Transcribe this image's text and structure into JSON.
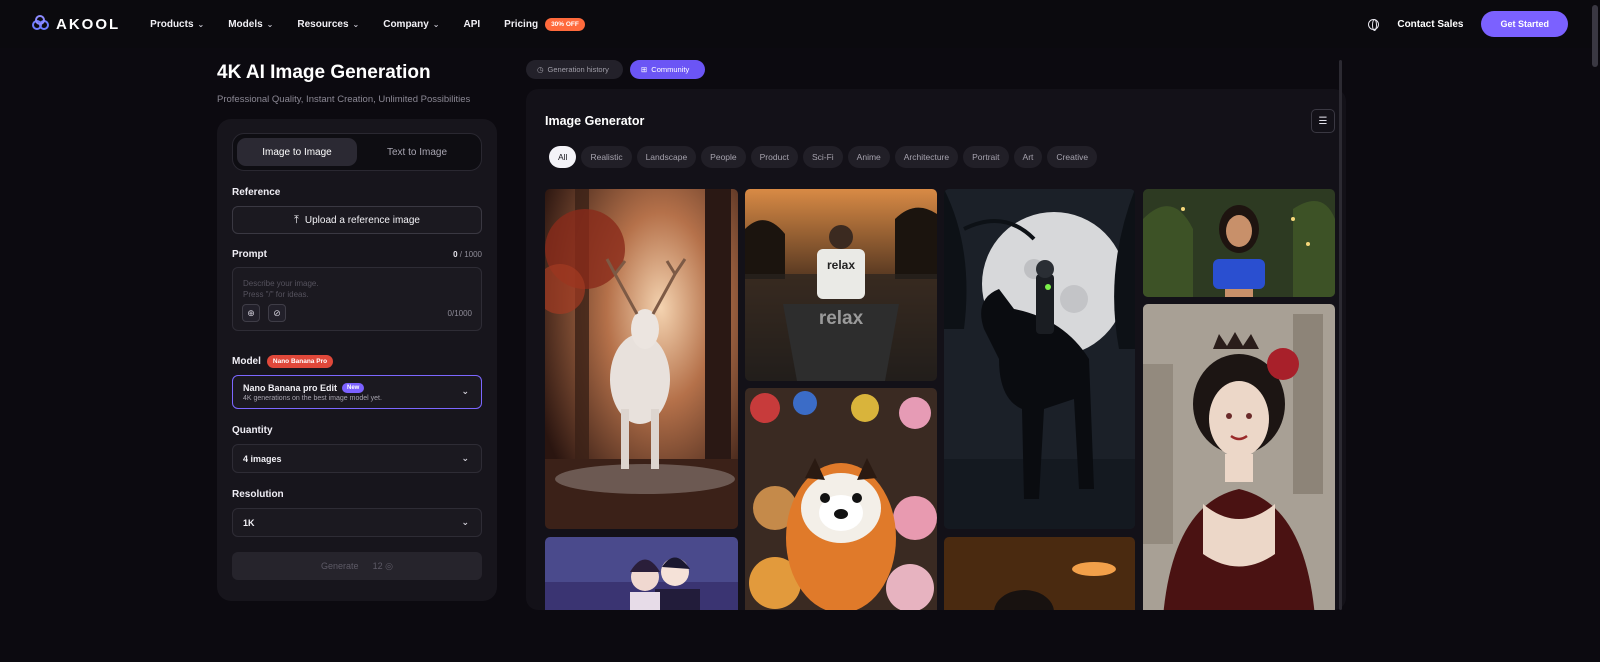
{
  "nav": {
    "brand": "AKOOL",
    "items": [
      {
        "label": "Products",
        "has_menu": true
      },
      {
        "label": "Models",
        "has_menu": true
      },
      {
        "label": "Resources",
        "has_menu": true
      },
      {
        "label": "Company",
        "has_menu": true
      },
      {
        "label": "API",
        "has_menu": false
      },
      {
        "label": "Pricing",
        "has_menu": false
      }
    ],
    "pricing_badge": "30% OFF",
    "contact": "Contact Sales",
    "cta": "Get Started"
  },
  "left": {
    "title": "4K AI Image Generation",
    "subtitle": "Professional Quality, Instant Creation, Unlimited Possibilities",
    "modes": [
      {
        "label": "Image to Image",
        "active": true
      },
      {
        "label": "Text to Image",
        "active": false
      }
    ],
    "reference_label": "Reference",
    "upload_label": "Upload a reference image",
    "prompt_label": "Prompt",
    "prompt_count": "0",
    "prompt_max": "/ 1000",
    "prompt_placeholder_1": "Describe your image.",
    "prompt_placeholder_2": "Press \"/\" for ideas.",
    "prompt_counter_inner": "0/1000",
    "model_label": "Model",
    "model_badge": "Nano Banana Pro",
    "model_name": "Nano Banana pro Edit",
    "model_new": "New",
    "model_desc": "4K generations on the best image model yet.",
    "quantity_label": "Quantity",
    "quantity_value": "4 images",
    "resolution_label": "Resolution",
    "resolution_value": "1K",
    "generate_label": "Generate",
    "generate_cost": "12"
  },
  "tabs": {
    "history": "Generation history",
    "community": "Community"
  },
  "gallery": {
    "title": "Image Generator",
    "chips": [
      "All",
      "Realistic",
      "Landscape",
      "People",
      "Product",
      "Sci-Fi",
      "Anime",
      "Architecture",
      "Portrait",
      "Art",
      "Creative"
    ],
    "active_chip": "All",
    "relax_text": "relax"
  },
  "colors": {
    "accent": "#7b61ff",
    "badge_orange": "#ff6a3c",
    "badge_red": "#e0483a",
    "background": "#0c0a10"
  }
}
